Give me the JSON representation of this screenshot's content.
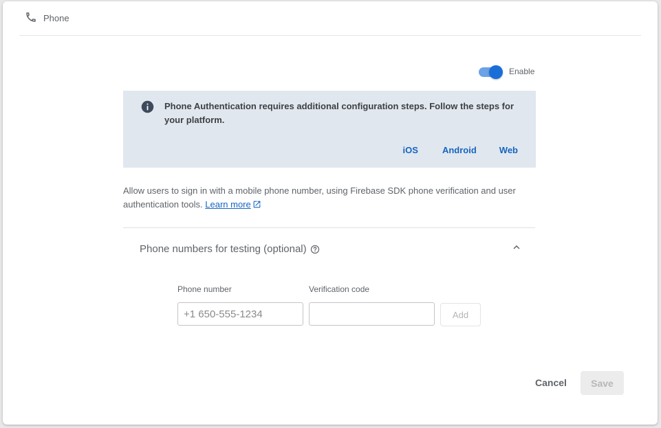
{
  "header": {
    "icon": "phone-icon",
    "title": "Phone"
  },
  "enable_toggle": {
    "label": "Enable",
    "enabled": true,
    "accent_color": "#1a6ed8"
  },
  "info_box": {
    "icon": "info-icon",
    "text": "Phone Authentication requires additional configuration steps. Follow the steps for your platform.",
    "links": [
      "iOS",
      "Android",
      "Web"
    ],
    "background": "#e1e7ee"
  },
  "description": {
    "text": "Allow users to sign in with a mobile phone number, using Firebase SDK phone verification and user authentication tools. ",
    "link_label": "Learn more",
    "link_icon": "external-link-icon"
  },
  "testing_section": {
    "title": "Phone numbers for testing (optional)",
    "help_icon": "help-icon",
    "collapse_icon": "chevron-up-icon",
    "phone_label": "Phone number",
    "phone_placeholder": "+1 650-555-1234",
    "phone_value": "",
    "code_label": "Verification code",
    "code_placeholder": "",
    "code_value": "",
    "add_label": "Add"
  },
  "footer": {
    "cancel_label": "Cancel",
    "save_label": "Save"
  }
}
